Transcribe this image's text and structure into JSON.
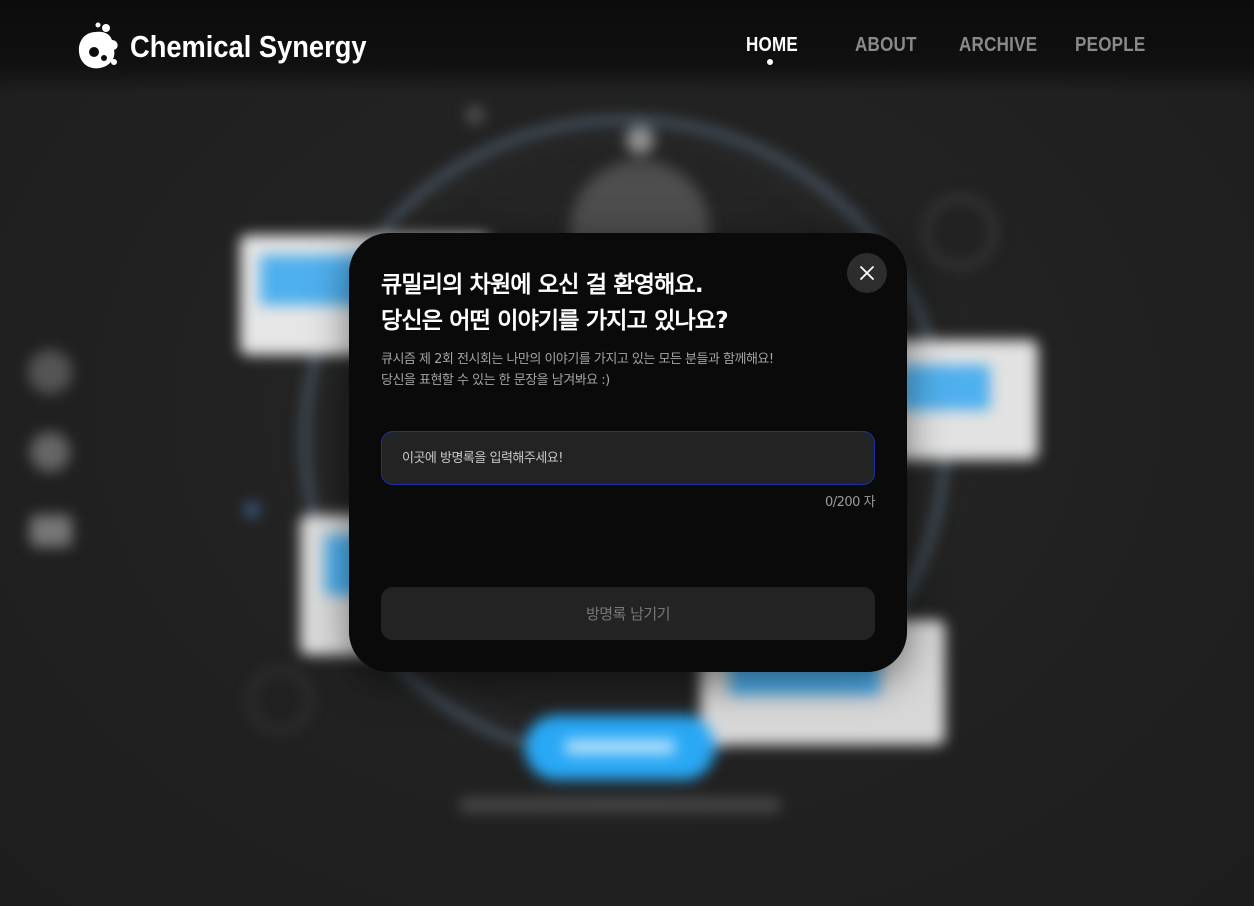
{
  "header": {
    "brand": "Chemical Synergy",
    "nav": [
      {
        "label": "HOME",
        "active": true
      },
      {
        "label": "ABOUT",
        "active": false
      },
      {
        "label": "ARCHIVE",
        "active": false
      },
      {
        "label": "PEOPLE",
        "active": false
      }
    ]
  },
  "modal": {
    "title_line1": "큐밀리의 차원에 오신 걸 환영해요.",
    "title_line2": "당신은 어떤 이야기를 가지고 있나요?",
    "desc_line1": "큐시즘 제 2회 전시회는 나만의 이야기를 가지고 있는 모든 분들과 함께해요!",
    "desc_line2": "당신을 표현할 수 있는 한 문장을 남겨봐요 :)",
    "input_placeholder": "이곳에 방명록을 입력해주세요!",
    "input_value": "",
    "counter": "0/200 자",
    "submit_label": "방명록 남기기",
    "close_icon": "close-icon"
  },
  "colors": {
    "accent_blue": "#29a8f5",
    "input_border": "#1f2fa8",
    "modal_bg": "#0a0a0a"
  }
}
